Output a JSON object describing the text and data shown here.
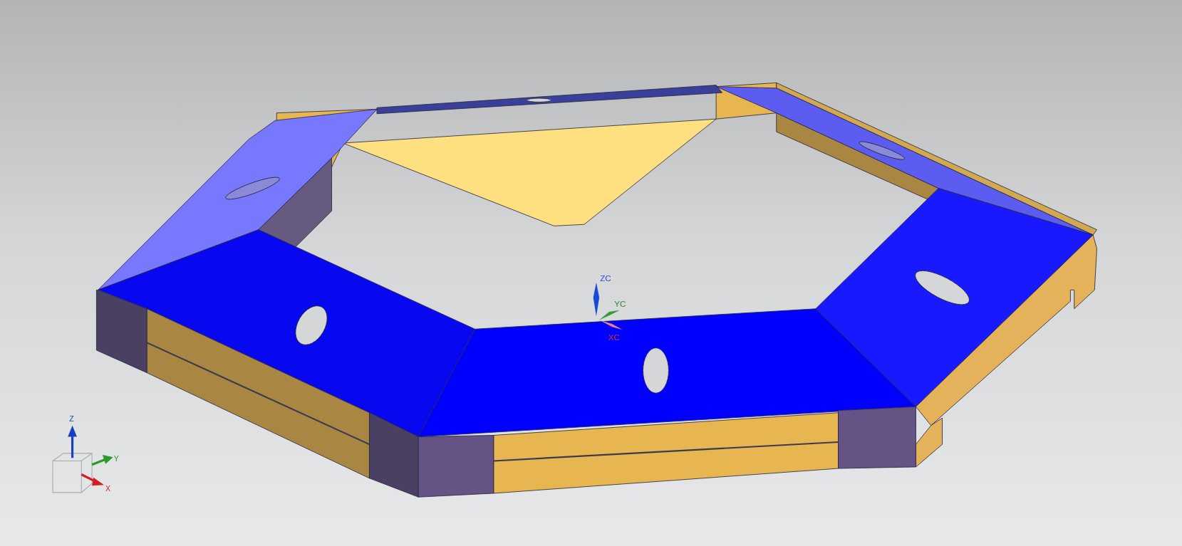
{
  "work_triad": {
    "z_label": "ZC",
    "y_label": "YC",
    "x_label": "XC"
  },
  "view_triad": {
    "z_label": "Z",
    "y_label": "Y",
    "x_label": "X"
  }
}
